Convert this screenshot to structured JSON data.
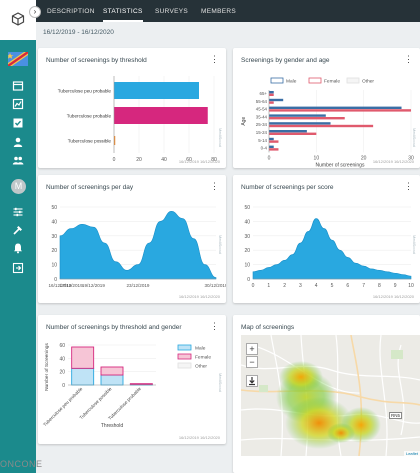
{
  "nav": {
    "tabs": [
      "DESCRIPTION",
      "STATISTICS",
      "SURVEYS",
      "MEMBERS"
    ],
    "active_tab": "STATISTICS"
  },
  "date_range": "16/12/2019 - 16/12/2020",
  "sidebar": {
    "avatar_initial": "M",
    "icons": [
      "dashboard-icon",
      "chart-icon",
      "checklist-icon",
      "person-icon",
      "group-icon",
      "settings-sliders-icon",
      "tools-icon",
      "bell-icon",
      "logout-icon"
    ],
    "accent": "#1b8a8c"
  },
  "cards": {
    "threshold": {
      "title": "Number of screenings by threshold",
      "date": "16/12/2019 16/12/2020",
      "watermark": "MediScout"
    },
    "gender_age": {
      "title": "Screenings by gender and age",
      "date": "16/12/2019 16/12/2020",
      "watermark": "MediScout"
    },
    "per_day": {
      "title": "Number of screenings per day",
      "date": "16/12/2019 16/12/2020",
      "watermark": "MediScout"
    },
    "per_score": {
      "title": "Number of screenings per score",
      "date": "16/12/2019 16/12/2020",
      "watermark": "MediScout"
    },
    "threshold_gender": {
      "title": "Number of screenings by threshold and gender",
      "date": "16/12/2019 16/12/2020",
      "watermark": "MediScout"
    },
    "map": {
      "title": "Map of screenings",
      "attribution": "Leaflet",
      "road_label": "RN5",
      "zoom_in": "+",
      "zoom_out": "−"
    }
  },
  "cropped_bottom_text": "ONCONE",
  "chart_data": [
    {
      "id": "threshold",
      "type": "bar",
      "orientation": "horizontal",
      "categories": [
        "Tuberculose peu probable",
        "Tuberculose probable",
        "Tuberculose possible"
      ],
      "values": [
        68,
        75,
        1
      ],
      "colors": [
        "#29a8e0",
        "#d6277e",
        "#ef8a2b"
      ],
      "xlim": [
        0,
        80
      ],
      "xticks": [
        0,
        20,
        40,
        60,
        80
      ]
    },
    {
      "id": "gender_age",
      "type": "bar",
      "orientation": "horizontal",
      "categories": [
        "65+",
        "55-64",
        "45-54",
        "35-44",
        "25-34",
        "15-24",
        "5-14",
        "0-4"
      ],
      "series": [
        {
          "name": "Male",
          "values": [
            1,
            3,
            28,
            12,
            13,
            8,
            1,
            1
          ],
          "color": "#3a6ea5"
        },
        {
          "name": "Female",
          "values": [
            1,
            1,
            30,
            16,
            22,
            10,
            2,
            2
          ],
          "color": "#e05a6d"
        },
        {
          "name": "Other",
          "values": [
            0,
            0,
            0,
            0,
            0,
            0,
            0,
            0
          ],
          "color": "#e0e0e0"
        }
      ],
      "xlabel": "Number of screenings",
      "ylabel": "Age",
      "xlim": [
        0,
        30
      ],
      "xticks": [
        0,
        10,
        20,
        30
      ]
    },
    {
      "id": "per_day",
      "type": "area",
      "x": [
        "16/12/2019",
        "17/12/2019",
        "18/12/2019",
        "19/12/2019",
        "20/12/2019",
        "21/12/2019",
        "22/12/2019",
        "23/12/2019",
        "24/12/2019",
        "25/12/2019",
        "26/12/2019",
        "27/12/2019",
        "28/12/2019",
        "29/12/2019",
        "30/12/2019"
      ],
      "values": [
        30,
        35,
        38,
        36,
        25,
        12,
        6,
        10,
        25,
        40,
        47,
        42,
        28,
        10,
        1
      ],
      "xticks": [
        "16/12/2019",
        "17/12/2019",
        "19/12/2019",
        "23/12/2019",
        "30/12/2019"
      ],
      "ylim": [
        0,
        50
      ],
      "yticks": [
        0,
        10,
        20,
        30,
        40,
        50
      ],
      "color": "#29a8e0"
    },
    {
      "id": "per_score",
      "type": "area",
      "x": [
        0,
        0.5,
        1,
        1.5,
        2,
        2.5,
        3,
        3.5,
        4,
        4.5,
        5,
        5.5,
        6,
        6.5,
        7,
        7.5,
        8,
        8.5,
        9,
        9.5,
        10
      ],
      "values": [
        5,
        6,
        8,
        10,
        13,
        17,
        25,
        33,
        42,
        35,
        27,
        20,
        15,
        11,
        9,
        7,
        6,
        5,
        4,
        3,
        2
      ],
      "xticks": [
        0,
        1,
        2,
        3,
        4,
        5,
        6,
        7,
        8,
        9,
        10
      ],
      "ylim": [
        0,
        50
      ],
      "yticks": [
        0,
        10,
        20,
        30,
        40,
        50
      ],
      "color": "#29a8e0"
    },
    {
      "id": "threshold_gender",
      "type": "bar",
      "stacked": true,
      "categories": [
        "Tuberculose peu probable",
        "Tuberculose possible",
        "Tuberculose probable"
      ],
      "series": [
        {
          "name": "Male",
          "values": [
            25,
            15,
            1
          ],
          "color": "#29a8e0"
        },
        {
          "name": "Female",
          "values": [
            32,
            12,
            1
          ],
          "color": "#d6277e"
        },
        {
          "name": "Other",
          "values": [
            0,
            0,
            0
          ],
          "color": "#e0e0e0"
        }
      ],
      "xlabel": "Threshold",
      "ylabel": "Number of Screenings",
      "ylim": [
        0,
        60
      ],
      "yticks": [
        0,
        20,
        40,
        60
      ]
    }
  ]
}
